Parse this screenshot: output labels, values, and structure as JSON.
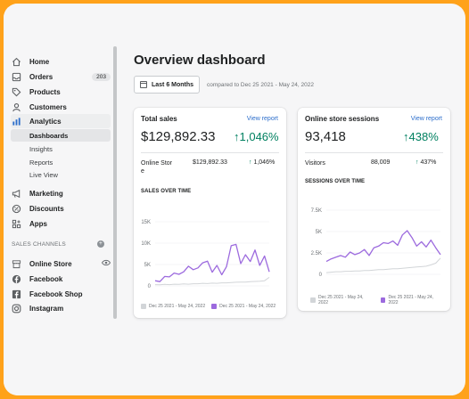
{
  "sidebar": {
    "home": "Home",
    "orders": "Orders",
    "orders_count": "203",
    "products": "Products",
    "customers": "Customers",
    "analytics": "Analytics",
    "sub": [
      "Dashboards",
      "Insights",
      "Reports",
      "Live View"
    ],
    "marketing": "Marketing",
    "discounts": "Discounts",
    "apps": "Apps",
    "sales_channels_label": "SALES CHANNELS",
    "channels": [
      "Online Store",
      "Facebook",
      "Facebook Shop",
      "Instagram"
    ]
  },
  "header": {
    "title": "Overview dashboard",
    "date_range_button": "Last 6 Months",
    "compare_text": "compared to Dec 25 2021 - May 24, 2022"
  },
  "total_sales": {
    "title": "Total sales",
    "link": "View report",
    "value": "$129,892.33",
    "change": "1,046%",
    "row_label_1": "Online Stor",
    "row_label_2": "e",
    "row_value": "$129,892.33",
    "row_change": "1,046%",
    "chart_title": "SALES OVER TIME",
    "legend": [
      "Dec 25 2021 - May 24, 2022",
      "Dec 25 2021 - May 24, 2022"
    ]
  },
  "sessions": {
    "title": "Online store sessions",
    "link": "View report",
    "value": "93,418",
    "change": "438%",
    "row_label": "Visitors",
    "row_value": "88,009",
    "row_change": "437%",
    "chart_title": "SESSIONS OVER TIME",
    "legend": [
      "Dec 25 2021 - May 24, 2022",
      "Dec 25 2021 - May 24, 2022"
    ]
  },
  "colors": {
    "accent_purple": "#9c6ade",
    "positive_green": "#008060",
    "link_blue": "#2c6ecb",
    "comparison_gray": "#d2d5d8",
    "frame_orange": "#ffa21a"
  },
  "chart_data": [
    {
      "type": "line",
      "title": "SALES OVER TIME",
      "yticks": [
        "15K",
        "10K",
        "5K",
        "0"
      ],
      "ylim": [
        0,
        15000
      ],
      "series": [
        {
          "name": "Dec 25 2021 - May 24, 2022",
          "values": [
            1200,
            1000,
            2200,
            2100,
            3000,
            2700,
            3300,
            4600,
            3800,
            4200,
            5400,
            5800,
            3200,
            4800,
            2600,
            4500,
            9400,
            9700,
            5200,
            7300,
            5700,
            8400,
            4800,
            7000,
            3300
          ]
        },
        {
          "name": "Dec 25 2021 - May 24, 2022",
          "values": [
            300,
            250,
            350,
            300,
            400,
            350,
            450,
            400,
            500,
            500,
            600,
            550,
            650,
            600,
            700,
            700,
            800,
            850,
            900,
            900,
            1000,
            1050,
            1100,
            1200,
            2000
          ]
        }
      ]
    },
    {
      "type": "line",
      "title": "SESSIONS OVER TIME",
      "yticks": [
        "7.5K",
        "5K",
        "2.5K",
        "0"
      ],
      "ylim": [
        0,
        7500
      ],
      "series": [
        {
          "name": "Dec 25 2021 - May 24, 2022",
          "values": [
            1500,
            1800,
            2000,
            2200,
            2000,
            2600,
            2300,
            2500,
            2900,
            2200,
            3100,
            3300,
            3700,
            3600,
            3900,
            3400,
            4600,
            5100,
            4300,
            3300,
            3800,
            3200,
            4000,
            3100,
            2300
          ]
        },
        {
          "name": "Dec 25 2021 - May 24, 2022",
          "values": [
            200,
            250,
            300,
            300,
            350,
            350,
            400,
            400,
            450,
            450,
            500,
            550,
            550,
            600,
            650,
            650,
            700,
            750,
            800,
            850,
            900,
            950,
            1100,
            1300,
            1900
          ]
        }
      ]
    }
  ]
}
